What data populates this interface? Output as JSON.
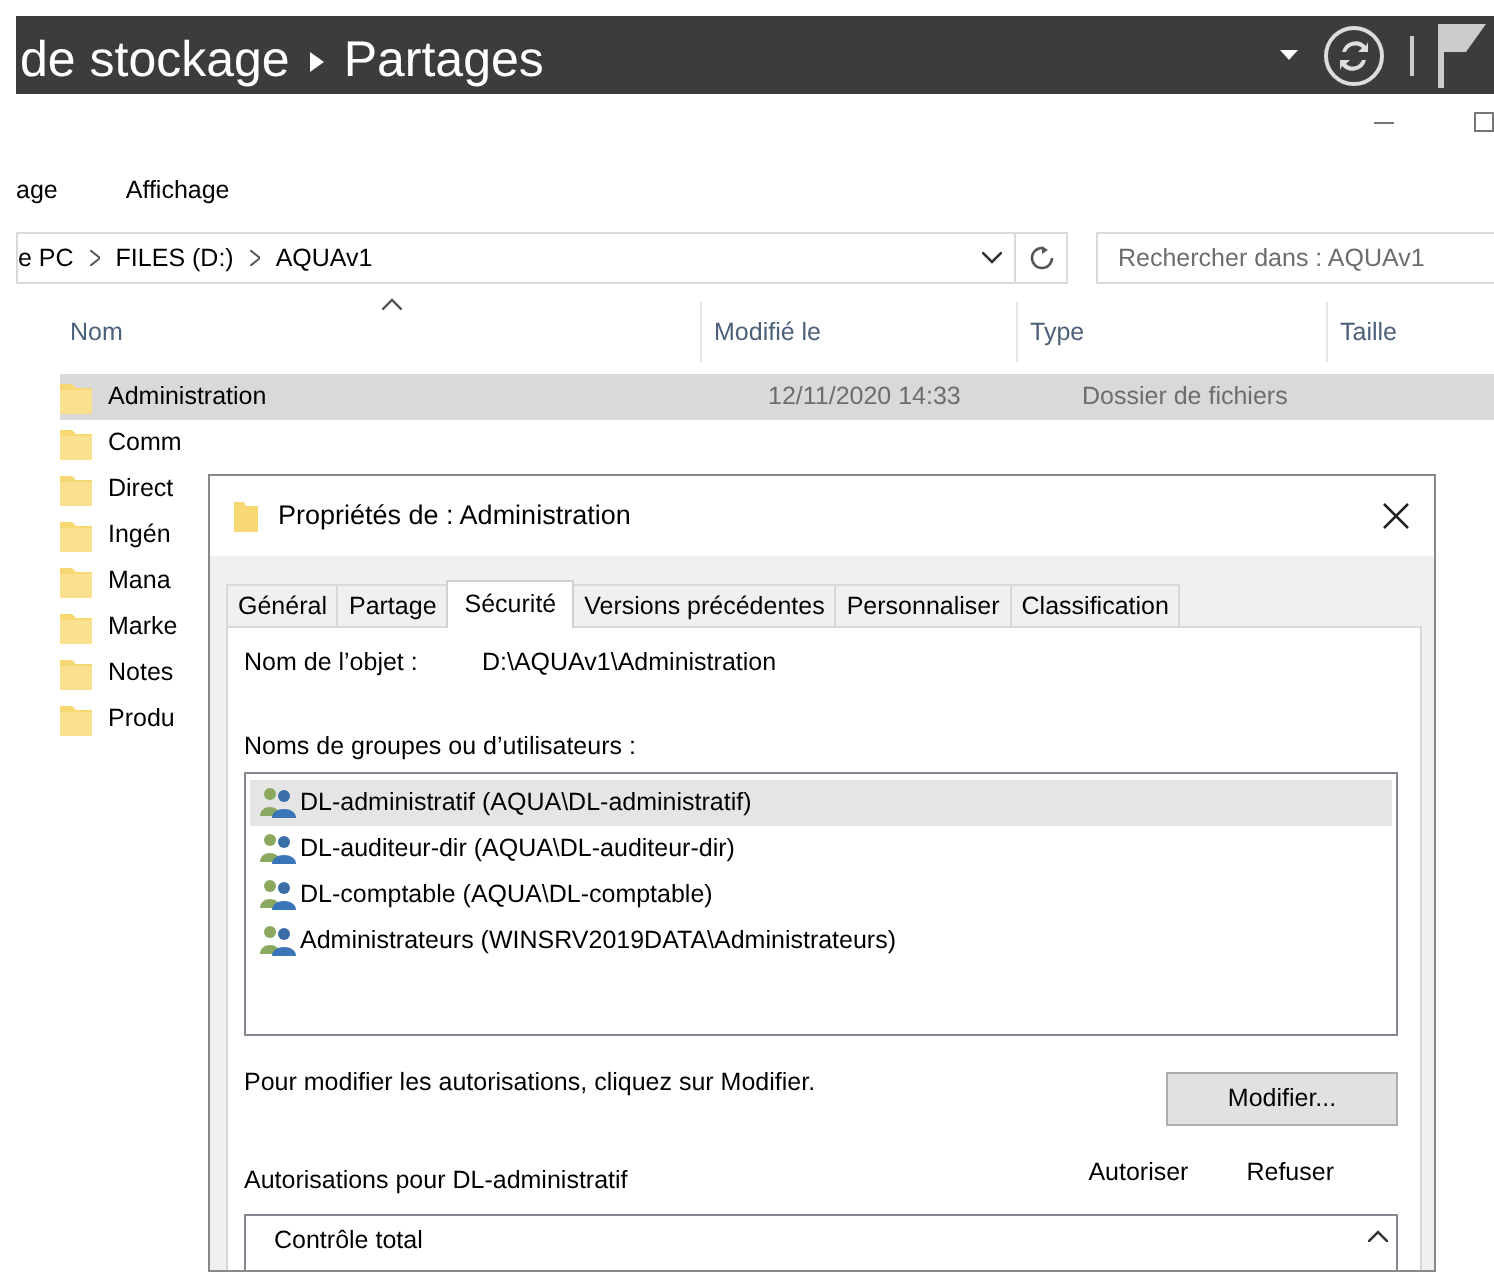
{
  "top_bar": {
    "breadcrumb": [
      "de stockage",
      "Partages"
    ]
  },
  "explorer": {
    "menu": [
      "age",
      "Affichage"
    ],
    "address": [
      "e PC",
      "FILES (D:)",
      "AQUAv1"
    ],
    "search": {
      "placeholder": "Rechercher dans : AQUAv1"
    },
    "columns": [
      {
        "label": "Nom",
        "sorted": true
      },
      {
        "label": "Modifié le",
        "sorted": false
      },
      {
        "label": "Type",
        "sorted": false
      },
      {
        "label": "Taille",
        "sorted": false
      }
    ],
    "rows": [
      {
        "name": "Administration",
        "modified": "12/11/2020 14:33",
        "type": "Dossier de fichiers",
        "selected": true
      },
      {
        "name": "Comm",
        "selected": false
      },
      {
        "name": "Direct",
        "selected": false
      },
      {
        "name": "Ingén",
        "selected": false
      },
      {
        "name": "Mana",
        "selected": false
      },
      {
        "name": "Marke",
        "selected": false
      },
      {
        "name": "Notes",
        "selected": false
      },
      {
        "name": "Produ",
        "selected": false
      }
    ]
  },
  "dialog": {
    "title": "Propriétés de : Administration",
    "tabs": [
      {
        "label": "Général",
        "selected": false
      },
      {
        "label": "Partage",
        "selected": false
      },
      {
        "label": "Sécurité",
        "selected": true
      },
      {
        "label": "Versions précédentes",
        "selected": false
      },
      {
        "label": "Personnaliser",
        "selected": false
      },
      {
        "label": "Classification",
        "selected": false
      }
    ],
    "object_label": "Nom de l’objet :",
    "object_value": "D:\\AQUAv1\\Administration",
    "groups_label": "Noms de groupes ou d’utilisateurs :",
    "groups": [
      {
        "name": "DL-administratif (AQUA\\DL-administratif)",
        "selected": true
      },
      {
        "name": "DL-auditeur-dir (AQUA\\DL-auditeur-dir)",
        "selected": false
      },
      {
        "name": "DL-comptable (AQUA\\DL-comptable)",
        "selected": false
      },
      {
        "name": "Administrateurs (WINSRV2019DATA\\Administrateurs)",
        "selected": false
      }
    ],
    "hint": "Pour modifier les autorisations, cliquez sur Modifier.",
    "edit_button": "Modifier...",
    "permissions_label": "Autorisations pour DL-administratif",
    "permission_columns": [
      "Autoriser",
      "Refuser"
    ],
    "permissions": [
      {
        "name": "Contrôle total"
      }
    ]
  }
}
